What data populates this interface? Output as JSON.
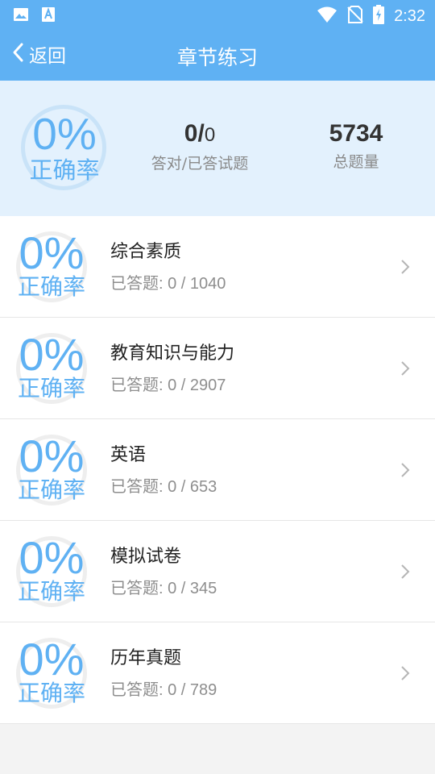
{
  "status_bar": {
    "time": "2:32",
    "icons": [
      "image-icon",
      "font-icon",
      "wifi-icon",
      "no-sim-icon",
      "battery-charging-icon"
    ]
  },
  "header": {
    "back_label": "返回",
    "title": "章节练习"
  },
  "summary": {
    "accuracy_value": "0%",
    "accuracy_label": "正确率",
    "correct_count": "0/",
    "answered_count": "0",
    "correct_answered_label": "答对/已答试题",
    "total": "5734",
    "total_label": "总题量"
  },
  "chapters": [
    {
      "accuracy": "0%",
      "accuracy_label": "正确率",
      "name": "综合素质",
      "progress": "已答题: 0 / 1040"
    },
    {
      "accuracy": "0%",
      "accuracy_label": "正确率",
      "name": "教育知识与能力",
      "progress": "已答题: 0 / 2907"
    },
    {
      "accuracy": "0%",
      "accuracy_label": "正确率",
      "name": "英语",
      "progress": "已答题: 0 / 653"
    },
    {
      "accuracy": "0%",
      "accuracy_label": "正确率",
      "name": "模拟试卷",
      "progress": "已答题: 0 / 345"
    },
    {
      "accuracy": "0%",
      "accuracy_label": "正确率",
      "name": "历年真题",
      "progress": "已答题: 0 / 789"
    }
  ],
  "colors": {
    "accent": "#5fb1f3",
    "summary_bg": "#e3f1fd"
  }
}
